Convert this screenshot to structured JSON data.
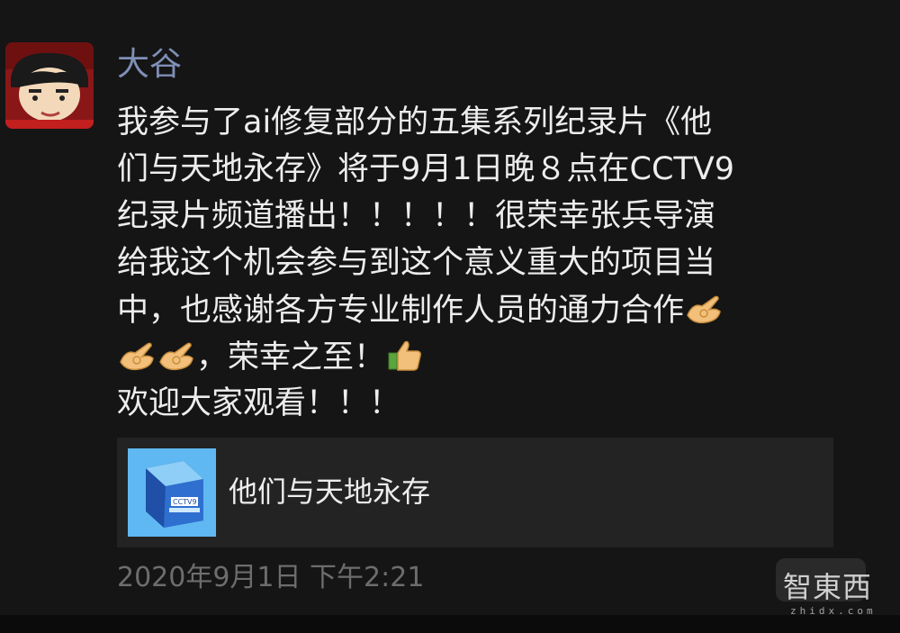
{
  "post": {
    "author": "大谷",
    "avatar_icon": "cartoon-avatar-icon",
    "lines": [
      [
        "我参与了ai修复部分的五集系列纪录片《他"
      ],
      [
        "们与天地永存》将于9月1日晚８点在CCTV9"
      ],
      [
        "纪录片频道播出！！！！！很荣幸张兵导演"
      ],
      [
        "给我这个机会参与到这个意义重大的项目当"
      ],
      [
        "中，也感谢各方专业制作人员的通力合作"
      ],
      [
        "，荣幸之至！"
      ],
      [
        "欢迎大家观看！！！"
      ]
    ],
    "emoji_icons": [
      "ok-hand-icon",
      "thumbs-up-icon"
    ],
    "link_card": {
      "title": "他们与天地永存",
      "thumb_icon": "cctv9-documentary-logo-icon"
    },
    "timestamp": "2020年9月1日 下午2:21"
  },
  "watermark": {
    "text": "智東西",
    "sub": "zhidx.com"
  },
  "colors": {
    "background": "#151515",
    "author": "#7f8fb6",
    "text": "#ededed",
    "timestamp": "#6d6d6d",
    "card": "#232323"
  }
}
